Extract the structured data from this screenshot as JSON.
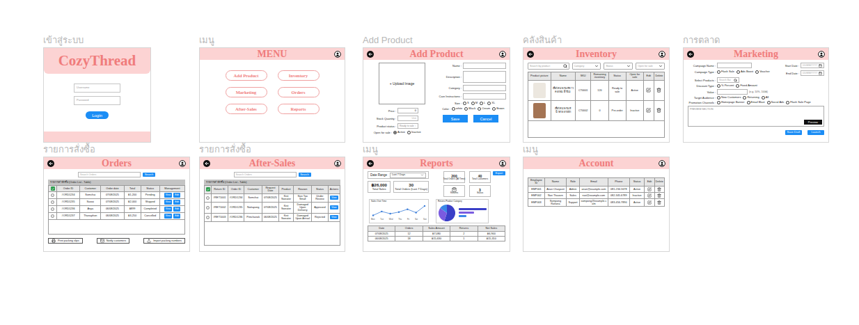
{
  "login": {
    "section_label": "เข้าสู่ระบบ",
    "logo": "CozyThread",
    "username_placeholder": "Username",
    "password_placeholder": "Password",
    "button": "Login"
  },
  "menu": {
    "section_label": "เมนู",
    "title": "MENU",
    "items": [
      "Add Product",
      "Inventory",
      "Marketing",
      "Orders",
      "After-Sales",
      "Reports"
    ]
  },
  "add_product": {
    "section_label": "Add Product",
    "title": "Add Product",
    "upload": "+ Upload Image",
    "fields": [
      {
        "label": "Name :",
        "tall": false
      },
      {
        "label": "Description :",
        "tall": true
      },
      {
        "label": "Category :",
        "tall": false
      },
      {
        "label": "Care Instructions :",
        "tall": false
      }
    ],
    "price": {
      "label": "Price :",
      "value": "0"
    },
    "stock": {
      "label": "Stock Quantity :",
      "placeholder": "Unit"
    },
    "status": {
      "label": "Product status :",
      "value": "Ready to sale"
    },
    "open_for_sale": {
      "label": "Open for sale :",
      "options": [
        {
          "label": "Active",
          "selected": true
        },
        {
          "label": "Inactive",
          "selected": false
        }
      ]
    },
    "size": {
      "label": "Size :",
      "options": [
        {
          "label": "S",
          "selected": false
        },
        {
          "label": "M",
          "selected": false
        },
        {
          "label": "L",
          "selected": false
        },
        {
          "label": "XL",
          "selected": false
        }
      ]
    },
    "color": {
      "label": "Color :",
      "options": [
        {
          "label": "white",
          "selected": false
        },
        {
          "label": "Black",
          "selected": false
        },
        {
          "label": "Cream",
          "selected": false
        },
        {
          "label": "Brown",
          "selected": false
        }
      ]
    },
    "buttons": [
      "Save",
      "Cancel"
    ]
  },
  "inventory": {
    "section_label": "คลังสินค้า",
    "title": "Inventory",
    "search_placeholder": "Search by product",
    "filters": [
      "Category",
      "Status",
      "Open for sale"
    ],
    "columns": [
      "Product picture",
      "Name",
      "SKU",
      "Remaining inventory",
      "Status",
      "Open for sale",
      "Edit",
      "Delete"
    ],
    "rows": [
      {
        "color": "#ece7df",
        "name": "เสื้อไหมพรมสีขาว คอกลม ผ้านิ่ม",
        "sku": "CT0001",
        "remaining": "120",
        "status": "Ready to sale",
        "open": "Active"
      },
      {
        "color": "#a47454",
        "name": "เสื้อไหมพรมสีน้ำตาล ลายถัก",
        "sku": "CT0002",
        "remaining": "0",
        "status": "Pre-order",
        "open": "Inactive"
      }
    ]
  },
  "marketing": {
    "section_label": "การตลาด",
    "title": "Marketing",
    "campaign_name": "Campaign Name :",
    "start_date": {
      "label": "Start Date :",
      "placeholder": "DD/MM/YYYY"
    },
    "end_date": {
      "label": "End Date :",
      "placeholder": "DD/MM/YYYY"
    },
    "campaign_type": {
      "label": "Campaign Type :",
      "options": [
        {
          "label": "Flash Sale",
          "selected": false
        },
        {
          "label": "Ads Boost",
          "selected": false
        },
        {
          "label": "Voucher",
          "selected": false
        }
      ]
    },
    "select_products": {
      "label": "Select Products :",
      "placeholder": "Search Bar"
    },
    "discount_type": {
      "label": "Discount Type :",
      "options": [
        {
          "label": "% Percent",
          "selected": false
        },
        {
          "label": "Fixed Amount",
          "selected": false
        }
      ]
    },
    "value": {
      "label": "Value :",
      "hint": "(e.g. 10%, 100฿)"
    },
    "target": {
      "label": "Target Audience :",
      "options": [
        {
          "label": "New Customers",
          "selected": false
        },
        {
          "label": "Returning",
          "selected": false
        },
        {
          "label": "All",
          "selected": false
        }
      ]
    },
    "channels": {
      "label": "Promotion Channels :",
      "options": [
        {
          "label": "Homepage Banner",
          "selected": false
        },
        {
          "label": "Email Blast",
          "selected": false
        },
        {
          "label": "Social Ads",
          "selected": false
        },
        {
          "label": "Flash Sale Page",
          "selected": false
        }
      ]
    },
    "preview_section": "PREVIEW SECTION",
    "preview_button": "Preview",
    "buttons": [
      "Save Draft",
      "Launch"
    ]
  },
  "orders": {
    "section_label": "รายการสั่งซื้อ",
    "title": "Orders",
    "search_placeholder": "Search Orders",
    "search_button": "Search",
    "table_title": "รายการคำสั่งซื้อ (Order List - Table)",
    "select_all": true,
    "columns": [
      "Order ID",
      "Customer",
      "Order date",
      "Total",
      "Status",
      "Management"
    ],
    "row_actions": [
      "View",
      "Edit"
    ],
    "rows": [
      {
        "order_id": "#ORD1234",
        "customer": "Somchai",
        "date": "07/08/2025",
        "total": "฿1,200",
        "status": "Pending",
        "selected": false
      },
      {
        "order_id": "#ORD1235",
        "customer": "Sawai",
        "date": "07/08/2025",
        "total": "฿2,000",
        "status": "Shipped",
        "selected": false
      },
      {
        "order_id": "#ORD1236",
        "customer": "Anya",
        "date": "06/08/2025",
        "total": "฿899",
        "status": "Completed",
        "selected": false
      },
      {
        "order_id": "#ORD1237",
        "customer": "Thanaphon",
        "date": "06/08/2025",
        "total": "฿3,250",
        "status": "Cancelled",
        "selected": false
      }
    ],
    "bottom_buttons": [
      "Print packing slips",
      "Notify customers",
      "Import packing numbers"
    ]
  },
  "after_sales": {
    "section_label": "รายการสั่งซื้อ",
    "title": "After-Sales",
    "search_placeholder": "Search Orders",
    "search_button": "Search",
    "table_title": "รายการคำสั่งซื้อ (Order List - Table)",
    "select_all": true,
    "columns": [
      "Return ID",
      "Order ID",
      "Customer",
      "Request Date",
      "Product",
      "Reason",
      "Status",
      "Actions"
    ],
    "row_action": "View",
    "rows": [
      {
        "return_id": "#RET1001",
        "order_id": "#ORD1234",
        "customer": "Somchai",
        "date": "07/08/2025",
        "product": "Knit Sweater",
        "reason": "Size Too Small",
        "status": "Under Review",
        "selected": false
      },
      {
        "return_id": "#RET1002",
        "order_id": "#ORD1235",
        "customer": "Nattapong",
        "date": "07/08/2025",
        "product": "Knit Sweater",
        "reason": "Damaged Upon Delivery",
        "status": "Approved",
        "selected": false
      },
      {
        "return_id": "#RET1003",
        "order_id": "#ORD1236",
        "customer": "Pimchanok",
        "date": "06/08/2025",
        "product": "Knit Sweater",
        "reason": "Damaged Upon Arrival",
        "status": "Rejected",
        "selected": false
      }
    ]
  },
  "reports": {
    "section_label": "เมนู",
    "title": "Reports",
    "date_range_label": "Date Range",
    "date_range_value": "Last 7 Days",
    "export": "Export",
    "stats": [
      {
        "value": "฿26,000",
        "label": "Total Sales"
      },
      {
        "value": "30",
        "label": "Total Orders (Last 7 Days)"
      }
    ],
    "small_stats": [
      {
        "value": "200",
        "label": "Total Orders (All Time)",
        "kind": "number"
      },
      {
        "value": "40",
        "label": "Total Customers",
        "kind": "number"
      },
      {
        "value": "",
        "label": "Returns",
        "kind": "icon"
      },
      {
        "value": "3",
        "label": "Status",
        "kind": "number"
      }
    ],
    "line_chart": {
      "title": "Sales Over Time",
      "x_labels": [
        "Mon",
        "Tue",
        "Wed",
        "Thu",
        "Fri",
        "Sat",
        "Sun"
      ],
      "values": [
        3200,
        3900,
        3500,
        3800,
        4300,
        3700,
        4900
      ]
    },
    "category_chart": {
      "title": "Returns Product Category",
      "segments": [
        {
          "value": 55,
          "color": "#3a3fc7"
        },
        {
          "value": 30,
          "color": "#7a5be0"
        },
        {
          "value": 15,
          "color": "#3b88e8"
        }
      ]
    },
    "table": {
      "columns": [
        "Date",
        "Orders",
        "Sales Amount",
        "Returns",
        "Net Sales"
      ],
      "rows": [
        [
          "07/08/2025",
          "12",
          "฿7,080",
          "2",
          "฿6,900"
        ],
        [
          "06/08/2025",
          "18",
          "฿15,630",
          "1",
          "฿15,310"
        ]
      ]
    }
  },
  "account": {
    "section_label": "เมนู",
    "title": "Account",
    "columns": [
      "Employee ID",
      "Name",
      "Role",
      "Email",
      "Phone",
      "Status",
      "Edit",
      "Delete"
    ],
    "rows": [
      {
        "id": "EMP001",
        "name": "Anan Chaiyasit",
        "role": "Admin",
        "email": "anan@example.com",
        "phone": "081-234-5678",
        "status": "Active"
      },
      {
        "id": "EMP002",
        "name": "Nari Thavorn",
        "role": "Sales",
        "email": "nari@example.com",
        "phone": "082-345-6789",
        "status": "Inactive"
      },
      {
        "id": "EMP003",
        "name": "Sompong Rattana",
        "role": "Support",
        "email": "sompong@example.com",
        "phone": "083-456-7890",
        "status": "Active"
      }
    ]
  }
}
